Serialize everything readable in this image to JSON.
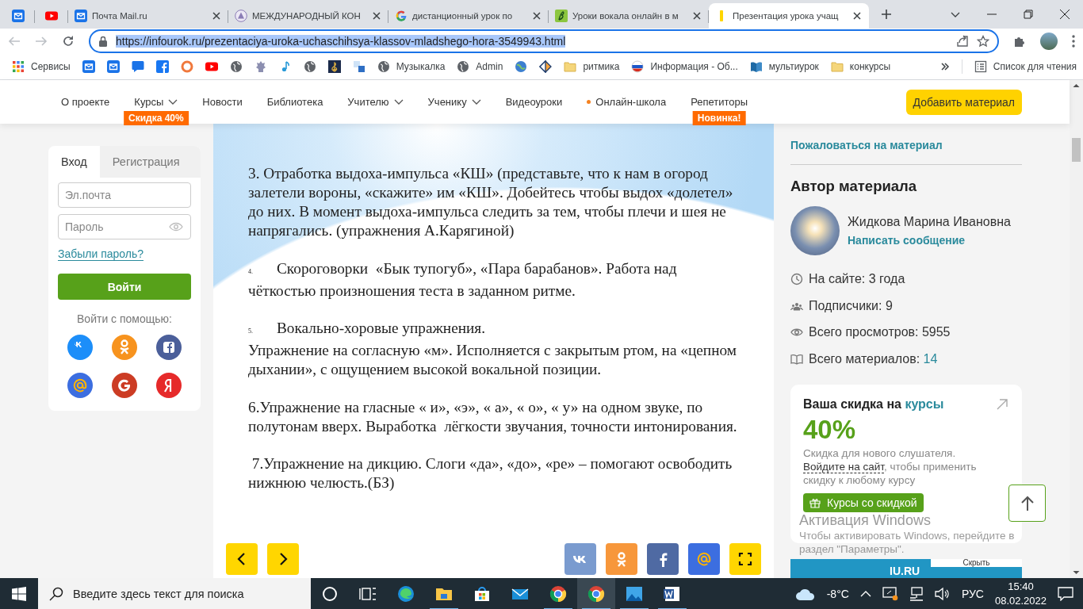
{
  "browser": {
    "tabs": [
      {
        "kind": "pinned",
        "selected": false
      },
      {
        "kind": "pinned",
        "selected": false
      },
      {
        "kind": "page",
        "title": "Почта Mail.ru",
        "selected": false
      },
      {
        "kind": "page",
        "title": "МЕЖДУНАРОДНЫЙ КОН",
        "selected": false
      },
      {
        "kind": "page",
        "title": "дистанционный урок по",
        "selected": false
      },
      {
        "kind": "page",
        "title": "Уроки вокала онлайн в м",
        "selected": false
      },
      {
        "kind": "page",
        "title": "Презентация урока учащ",
        "selected": true
      }
    ],
    "address": "https://infourok.ru/prezentaciya-uroka-uchaschihsya-klassov-mladshego-hora-3549943.html",
    "address_selected": true,
    "bookmarks": [
      {
        "kind": "link",
        "label": "Сервисы"
      },
      {
        "kind": "icon"
      },
      {
        "kind": "icon"
      },
      {
        "kind": "icon"
      },
      {
        "kind": "icon"
      },
      {
        "kind": "icon"
      },
      {
        "kind": "icon"
      },
      {
        "kind": "icon"
      },
      {
        "kind": "icon"
      },
      {
        "kind": "icon"
      },
      {
        "kind": "icon"
      },
      {
        "kind": "icon"
      },
      {
        "kind": "icon"
      },
      {
        "kind": "link",
        "label": "Музыкалка"
      },
      {
        "kind": "link",
        "label": "Admin"
      },
      {
        "kind": "icon"
      },
      {
        "kind": "icon"
      },
      {
        "kind": "link",
        "label": "ритмика"
      },
      {
        "kind": "link",
        "label": "Информация - Об..."
      },
      {
        "kind": "link",
        "label": "мультиурок"
      },
      {
        "kind": "link",
        "label": "конкурсы"
      }
    ],
    "reading_list": "Список для чтения"
  },
  "site_nav": {
    "items": [
      {
        "label": "О проекте",
        "dropdown": false
      },
      {
        "label": "Курсы",
        "dropdown": true,
        "badge": "Скидка 40%"
      },
      {
        "label": "Новости",
        "dropdown": false
      },
      {
        "label": "Библиотека",
        "dropdown": false
      },
      {
        "label": "Учителю",
        "dropdown": true
      },
      {
        "label": "Ученику",
        "dropdown": true
      },
      {
        "label": "Видеоуроки",
        "dropdown": false
      },
      {
        "label": "Онлайн-школа",
        "dropdown": false,
        "dot": true
      },
      {
        "label": "Репетиторы",
        "dropdown": false,
        "badge": "Новинка!"
      }
    ],
    "add_button": "Добавить материал"
  },
  "login": {
    "tabs": [
      {
        "label": "Вход",
        "selected": true
      },
      {
        "label": "Регистрация",
        "selected": false
      }
    ],
    "email": {
      "placeholder": "Эл.почта"
    },
    "password": {
      "placeholder": "Пароль"
    },
    "forgot": "Забыли пароль?",
    "submit": "Войти",
    "social_title": "Войти с помощью:"
  },
  "slide": {
    "paragraphs": [
      {
        "text": "3. Отработка выдоха-импульса «КШ» (представьте, что к нам в огород залетели вороны, «скажите» им «КШ». Добейтесь чтобы выдох «долетел» до них. В момент выдоха-импульса следить за тем, чтобы плечи и шея не напрягались. (упражнения А.Карягиной)"
      },
      {
        "marker": "4.",
        "text": "Скороговорки  «Бык тупогуб», «Пара барабанов». Работа над чёткостью произношения теста в заданном ритме."
      },
      {
        "marker": "5.",
        "text": "Вокально-хоровые упражнения.",
        "continuation": "Упражнение на согласную «м». Исполняется с закрытым ртом, на «цепном дыхании», с ощущением высокой вокальной позиции."
      },
      {
        "text": "6.Упражнение на гласные « и», «э», « а», « о», « у» на одном звуке, по полутонам вверх. Выработка  лёгкости звучания, точности интонирования."
      },
      {
        "text": " 7.Упражнение на дикцию. Слоги «да», «до», «ре» – помогают освободить нижнюю челюсть.(БЗ)"
      }
    ]
  },
  "author": {
    "complain": "Пожаловаться на материал",
    "heading": "Автор материала",
    "name": "Жидкова Марина Ивановна",
    "message": "Написать сообщение",
    "stats": [
      {
        "label": "На сайте: ",
        "value": "3 года",
        "highlight": false
      },
      {
        "label": "Подписчики: ",
        "value": "9",
        "highlight": false
      },
      {
        "label": "Всего просмотров: ",
        "value": "5955",
        "highlight": false
      },
      {
        "label": "Всего материалов: ",
        "value": "14",
        "highlight": true
      }
    ]
  },
  "promo": {
    "title": "Ваша скидка на ",
    "title_link": "курсы",
    "percent": "40%",
    "line1": "Скидка для нового слушателя.",
    "link": "Войдите на сайт",
    "rest": ", чтобы применить скидку к любому курсу",
    "button": "Курсы со скидкой"
  },
  "banner": {
    "logo": "IU.RU",
    "hide": "Скрыть"
  },
  "windows_activation": {
    "title": "Активация Windows",
    "text": "Чтобы активировать Windows, перейдите в раздел \"Параметры\"."
  },
  "taskbar": {
    "search_placeholder": "Введите здесь текст для поиска",
    "apps": [
      {
        "running": false,
        "selected": false
      },
      {
        "running": false,
        "selected": false
      },
      {
        "running": false,
        "selected": false
      },
      {
        "running": true,
        "selected": false
      },
      {
        "running": false,
        "selected": false
      },
      {
        "running": false,
        "selected": false
      },
      {
        "running": true,
        "selected": false
      },
      {
        "running": true,
        "selected": true
      },
      {
        "running": true,
        "selected": false
      },
      {
        "running": true,
        "selected": false
      }
    ],
    "weather": "-8°C",
    "language": "РУС",
    "time": "15:40",
    "date": "08.02.2022"
  }
}
